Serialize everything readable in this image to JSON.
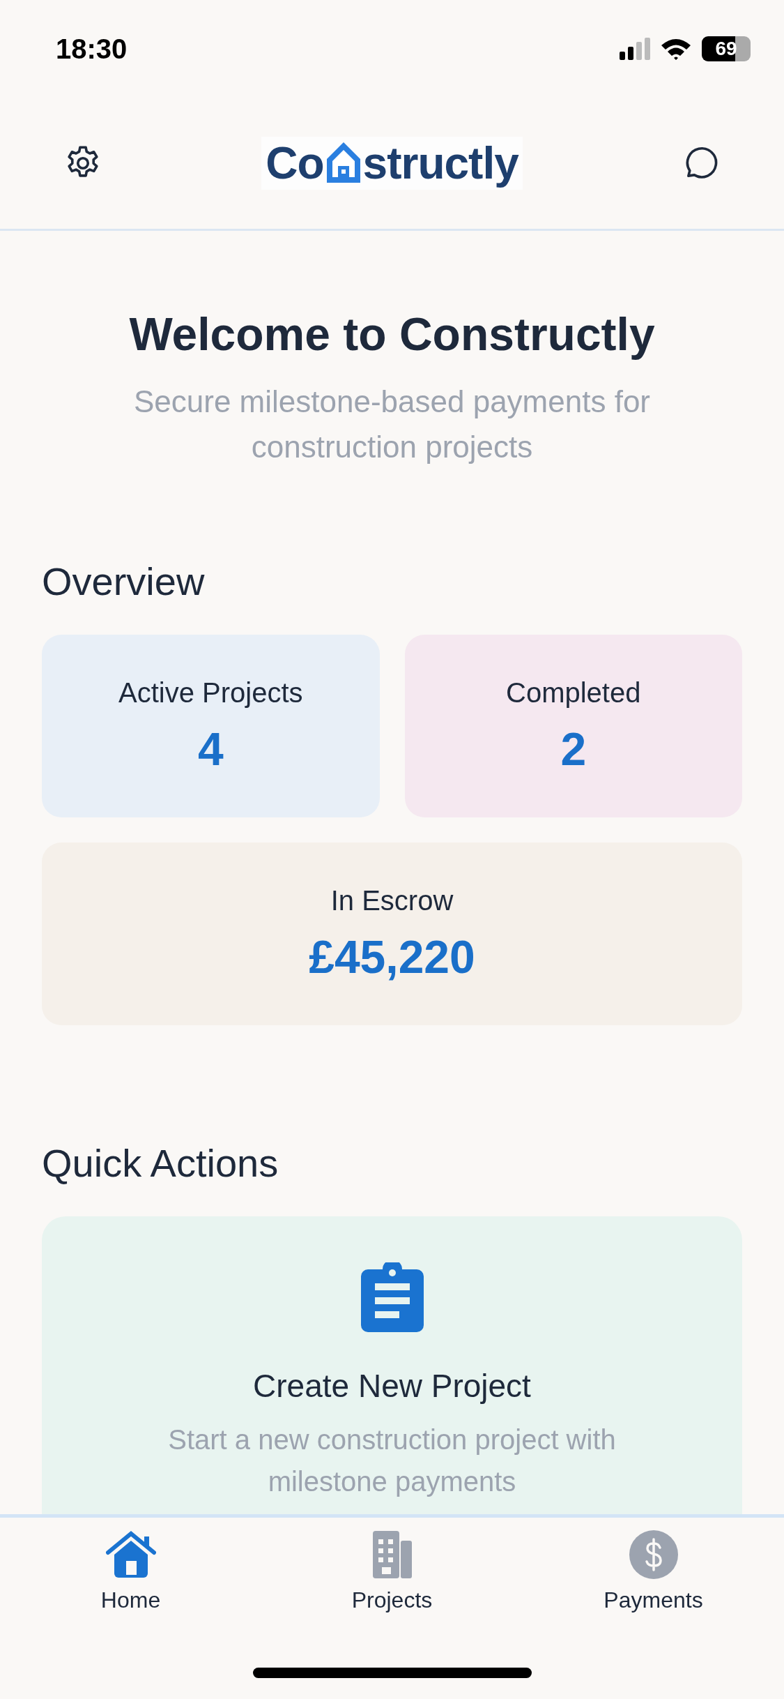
{
  "status_bar": {
    "time": "18:30",
    "battery": "69"
  },
  "header": {
    "logo": [
      "Co",
      "structly"
    ]
  },
  "welcome": {
    "title": "Welcome to Constructly",
    "subtitle": "Secure milestone-based payments for construction projects"
  },
  "overview": {
    "heading": "Overview",
    "stats": [
      {
        "label": "Active Projects",
        "value": "4",
        "color": "#e8eff7"
      },
      {
        "label": "Completed",
        "value": "2",
        "color": "#f5e8f0"
      },
      {
        "label": "In Escrow",
        "value": "£45,220",
        "color": "#f5f0ea"
      }
    ]
  },
  "quick_actions": {
    "heading": "Quick Actions",
    "actions": [
      {
        "title": "Create New Project",
        "description": "Start a new construction project with milestone payments"
      }
    ]
  },
  "tab_bar": [
    {
      "label": "Home",
      "kind": "home",
      "selected": true
    },
    {
      "label": "Projects",
      "kind": "projects",
      "selected": false
    },
    {
      "label": "Payments",
      "kind": "payments",
      "selected": false
    }
  ]
}
